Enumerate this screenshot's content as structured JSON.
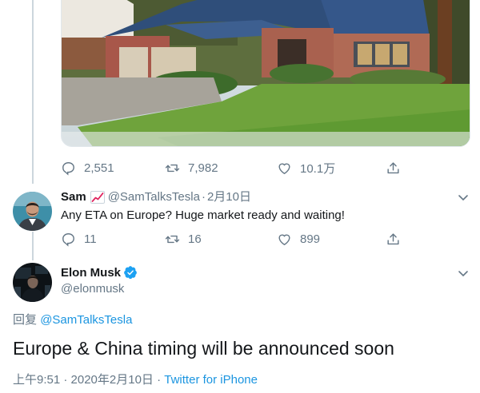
{
  "tweet_above": {
    "photo_alt": "House with tile roof, brick walls, garage and green lawn",
    "actions": {
      "reply_count": "2,551",
      "retweet_count": "7,982",
      "like_count": "10.1万"
    }
  },
  "reply": {
    "name": "Sam",
    "handle": "@SamTalksTesla",
    "separator": "·",
    "date": "2月10日",
    "text": "Any ETA on Europe? Huge market ready and waiting!",
    "actions": {
      "reply_count": "11",
      "retweet_count": "16",
      "like_count": "899"
    }
  },
  "main_tweet": {
    "name": "Elon Musk",
    "handle": "@elonmusk",
    "replying_prefix": "回复",
    "replying_to": "@SamTalksTesla",
    "text": "Europe & China timing will be announced soon",
    "time": "上午9:51 · 2020年2月10日 · ",
    "source": "Twitter for iPhone"
  },
  "colors": {
    "link": "#1b95e0",
    "muted": "#657786",
    "verified": "#1da1f2"
  },
  "icons": [
    "reply-icon",
    "retweet-icon",
    "like-icon",
    "share-icon",
    "chevron-down-icon",
    "verified-badge-icon",
    "chart-increasing-emoji"
  ]
}
